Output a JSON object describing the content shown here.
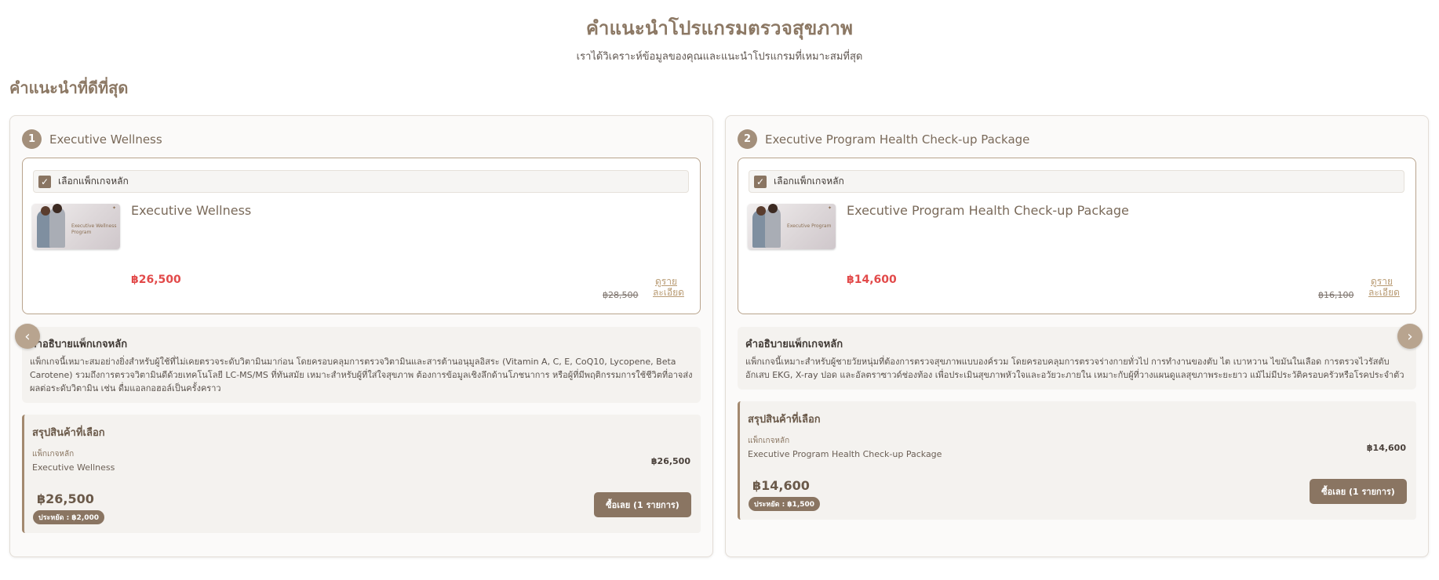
{
  "header": {
    "title": "คำแนะนำโปรแกรมตรวจสุขภาพ",
    "subtitle": "เราได้วิเคราะห์ข้อมูลของคุณและแนะนำโปรแกรมที่เหมาะสมที่สุด"
  },
  "section_title": "คำแนะนำที่ดีที่สุด",
  "nav": {
    "prev_icon": "chevron-left-icon",
    "next_icon": "chevron-right-icon"
  },
  "colors": {
    "accent": "#8a7562",
    "price_red": "#e24a4a",
    "link": "#b89a72"
  },
  "recommendations": [
    {
      "rank": "1",
      "title": "Executive Wellness",
      "select_label": "เลือกแพ็กเกจหลัก",
      "thumb_text": "Executive Wellness Program",
      "package_name": "Executive Wellness",
      "price": "฿26,500",
      "old_price": "฿28,500",
      "detail_link": "ดูราย ละเอียด",
      "description_title": "คำอธิบายแพ็กเกจหลัก",
      "description": "แพ็กเกจนี้เหมาะสมอย่างยิ่งสำหรับผู้ใช้ที่ไม่เคยตรวจระดับวิตามินมาก่อน โดยครอบคลุมการตรวจวิตามินและสารต้านอนุมูลอิสระ (Vitamin A, C, E, CoQ10, Lycopene, Beta Carotene) รวมถึงการตรวจวิตามินดีด้วยเทคโนโลยี LC-MS/MS ที่ทันสมัย เหมาะสำหรับผู้ที่ใส่ใจสุขภาพ ต้องการข้อมูลเชิงลึกด้านโภชนาการ หรือผู้ที่มีพฤติกรรมการใช้ชีวิตที่อาจส่งผลต่อระดับวิตามิน เช่น ดื่มแอลกอฮอล์เป็นครั้งคราว",
      "summary": {
        "title": "สรุปสินค้าที่เลือก",
        "category": "แพ็กเกจหลัก",
        "item_name": "Executive Wellness",
        "item_price": "฿26,500",
        "total": "฿26,500",
        "savings": "ประหยัด : ฿2,000",
        "buy_label": "ซื้อเลย (1 รายการ)"
      }
    },
    {
      "rank": "2",
      "title": "Executive Program Health Check-up Package",
      "select_label": "เลือกแพ็กเกจหลัก",
      "thumb_text": "Executive Program",
      "package_name": "Executive Program Health Check-up Package",
      "price": "฿14,600",
      "old_price": "฿16,100",
      "detail_link": "ดูราย ละเอียด",
      "description_title": "คำอธิบายแพ็กเกจหลัก",
      "description": "แพ็กเกจนี้เหมาะสำหรับผู้ชายวัยหนุ่มที่ต้องการตรวจสุขภาพแบบองค์รวม โดยครอบคลุมการตรวจร่างกายทั่วไป การทำงานของตับ ไต เบาหวาน ไขมันในเลือด การตรวจไวรัสตับอักเสบ EKG, X-ray ปอด และอัลตราซาวด์ช่องท้อง เพื่อประเมินสุขภาพหัวใจและอวัยวะภายใน เหมาะกับผู้ที่วางแผนดูแลสุขภาพระยะยาว แม้ไม่มีประวัติครอบครัวหรือโรคประจำตัว",
      "summary": {
        "title": "สรุปสินค้าที่เลือก",
        "category": "แพ็กเกจหลัก",
        "item_name": "Executive Program Health Check-up Package",
        "item_price": "฿14,600",
        "total": "฿14,600",
        "savings": "ประหยัด : ฿1,500",
        "buy_label": "ซื้อเลย (1 รายการ)"
      }
    }
  ]
}
